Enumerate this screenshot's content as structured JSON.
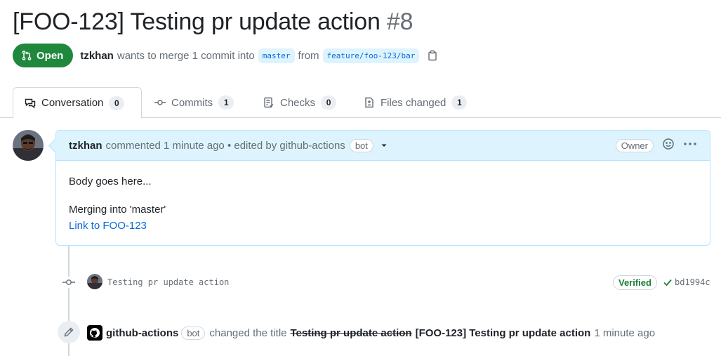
{
  "pr": {
    "title": "[FOO-123] Testing pr update action",
    "number": "#8",
    "state": "Open",
    "author": "tzkhan",
    "merge_text": "wants to merge 1 commit into",
    "base_branch": "master",
    "from_text": "from",
    "head_branch": "feature/foo-123/bar"
  },
  "tabs": [
    {
      "label": "Conversation",
      "count": "0",
      "icon": "conversation-icon"
    },
    {
      "label": "Commits",
      "count": "1",
      "icon": "commit-icon"
    },
    {
      "label": "Checks",
      "count": "0",
      "icon": "checklist-icon"
    },
    {
      "label": "Files changed",
      "count": "1",
      "icon": "file-diff-icon"
    }
  ],
  "comment": {
    "author": "tzkhan",
    "meta": "commented 1 minute ago • edited by github-actions",
    "bot_badge": "bot",
    "owner_badge": "Owner",
    "body_line1": "Body goes here...",
    "body_line2": "Merging into 'master'",
    "link_text": "Link to FOO-123"
  },
  "commit": {
    "message": "Testing pr update action",
    "verified": "Verified",
    "sha": "bd1994c"
  },
  "event": {
    "actor": "github-actions",
    "bot_badge": "bot",
    "action": "changed the title",
    "old_title": "Testing pr update action",
    "new_title": "[FOO-123] Testing pr update action",
    "time": "1 minute ago"
  },
  "colors": {
    "open_green": "#1f883d",
    "link_blue": "#0969da",
    "header_blue": "#ddf4ff",
    "verified_green": "#1a7f37"
  }
}
